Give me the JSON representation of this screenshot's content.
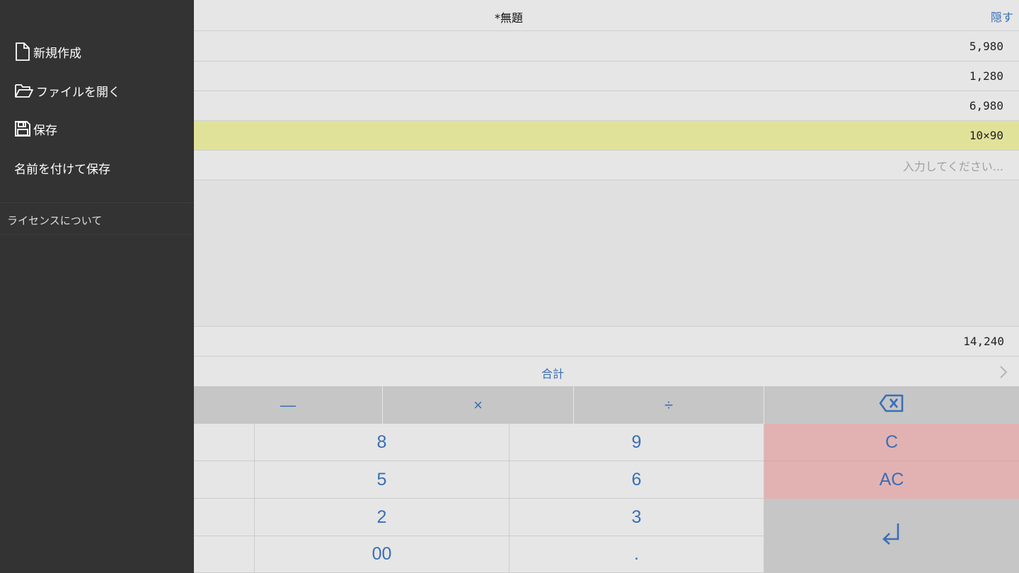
{
  "sidebar": {
    "menu": [
      {
        "label": "新規作成",
        "icon": "file-icon"
      },
      {
        "label": "ファイルを開く",
        "icon": "folder-open-icon"
      },
      {
        "label": "保存",
        "icon": "floppy-disk-icon"
      },
      {
        "label": "名前を付けて保存",
        "icon": ""
      }
    ],
    "license_label": "ライセンスについて"
  },
  "header": {
    "title": "*無題",
    "hide_label": "隠す"
  },
  "lines": [
    {
      "value": "5,980"
    },
    {
      "value": "1,280"
    },
    {
      "value": "6,980"
    },
    {
      "value": "10×90",
      "selected": true
    }
  ],
  "input": {
    "placeholder": "入力してください..."
  },
  "total": {
    "value": "14,240",
    "label": "合計"
  },
  "keypad": {
    "operators": [
      "—",
      "×",
      "÷"
    ],
    "backspace_icon": "backspace-icon",
    "rows": [
      [
        "8",
        "9"
      ],
      [
        "5",
        "6"
      ],
      [
        "2",
        "3"
      ],
      [
        "00",
        "."
      ]
    ],
    "clear": "C",
    "all_clear": "AC",
    "enter_icon": "enter-icon"
  },
  "colors": {
    "sidebar_bg": "#333333",
    "accent": "#3a6fb5",
    "selected_row": "#e1e29a",
    "clear_keys": "#e2b2b2",
    "operator_keys": "#c6c6c6"
  }
}
